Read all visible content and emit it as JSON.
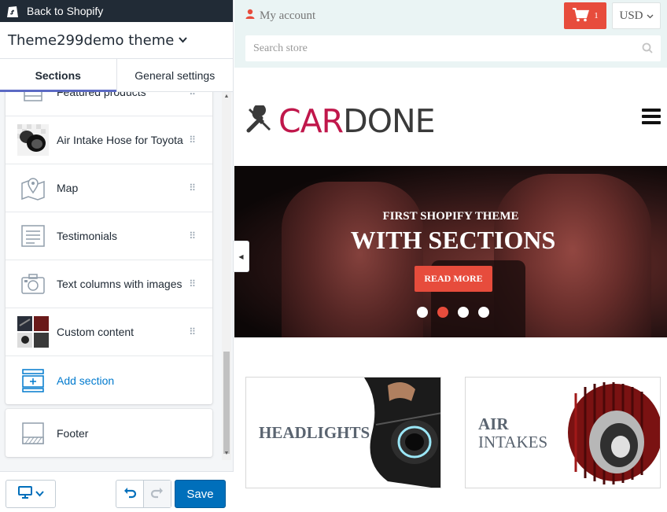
{
  "topbar": {
    "back_label": "Back to Shopify"
  },
  "theme": {
    "name": "Theme299demo theme"
  },
  "tabs": [
    {
      "label": "Sections"
    },
    {
      "label": "General settings"
    }
  ],
  "sections": {
    "items": [
      {
        "label": "Featured products",
        "icon": "product-grid-icon"
      },
      {
        "label": "Air Intake Hose for Toyota",
        "icon": "product-thumbnail"
      },
      {
        "label": "Map",
        "icon": "map-pin-icon"
      },
      {
        "label": "Testimonials",
        "icon": "text-block-icon"
      },
      {
        "label": "Text columns with images",
        "icon": "camera-icon"
      },
      {
        "label": "Custom content",
        "icon": "image-collage-icon"
      }
    ],
    "add_label": "Add section",
    "footer_label": "Footer"
  },
  "bottombar": {
    "save_label": "Save"
  },
  "store": {
    "my_account": "My account",
    "cart_count": "1",
    "currency": "USD",
    "search_placeholder": "Search store",
    "logo_part1": "CAR",
    "logo_part2": "DONE",
    "hero": {
      "subtitle": "FIRST SHOPIFY THEME",
      "title": "WITH SECTIONS",
      "button": "READ MORE",
      "active_slide": 2,
      "slide_count": 4
    },
    "banners": [
      {
        "line1": "HEADLIGHTS",
        "line2": ""
      },
      {
        "line1": "AIR",
        "line2": "INTAKES"
      }
    ]
  },
  "colors": {
    "accent": "#e74c3c",
    "brand": "#c0174b",
    "save": "#006fbb",
    "topbar": "#212b36"
  }
}
